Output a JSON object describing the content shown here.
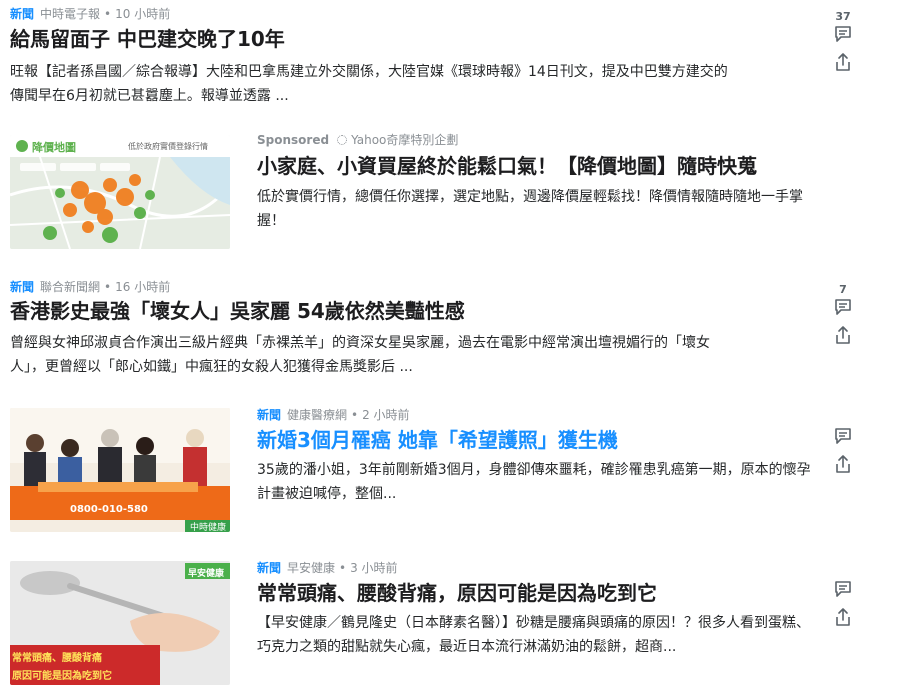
{
  "feed": [
    {
      "category": "新聞",
      "source": "中時電子報",
      "time": "10 小時前",
      "title": "給馬留面子 中巴建交晚了10年",
      "summary": "旺報【記者孫昌國／綜合報導】大陸和巴拿馬建立外交關係，大陸官媒《環球時報》14日刊文，提及中巴雙方建交的傳聞早在6月初就已甚囂塵上。報導並透露 ...",
      "comments": "37"
    },
    {
      "sponsored_label": "Sponsored",
      "source": "Yahoo奇摩特別企劃",
      "title": "小家庭、小資買屋終於能鬆口氣！【降價地圖】隨時快蒐",
      "summary": "低於實價行情，總價任你選擇，選定地點，週邊降價屋輕鬆找！降價情報隨時隨地一手掌握！",
      "thumb_logo": "降價地圖",
      "thumb_tag": "低於政府實價登錄行情"
    },
    {
      "category": "新聞",
      "source": "聯合新聞網",
      "time": "16 小時前",
      "title": "香港影史最強「壞女人」吳家麗 54歲依然美豔性感",
      "summary": "曾經與女神邱淑貞合作演出三級片經典「赤裸羔羊」的資深女星吳家麗，過去在電影中經常演出壇視媚行的「壞女人」，更曾經以「郎心如鐵」中瘋狂的女殺人犯獲得金馬獎影后 ...",
      "comments": "7"
    },
    {
      "category": "新聞",
      "source": "健康醫療網",
      "time": "2 小時前",
      "title": "新婚3個月罹癌 她靠「希望護照」獲生機",
      "summary": "35歲的潘小姐，3年前剛新婚3個月，身體卻傳來噩耗，確診罹患乳癌第一期，原本的懷孕計畫被迫喊停，整個...",
      "comments": "",
      "thumb_banner": "0800-010-580",
      "thumb_tag": "中時健康"
    },
    {
      "category": "新聞",
      "source": "早安健康",
      "time": "3 小時前",
      "title": "常常頭痛、腰酸背痛，原因可能是因為吃到它",
      "summary": "【早安健康／鶴見隆史（日本酵素名醫）】砂糖是腰痛與頭痛的原因！？很多人看到蛋糕、巧克力之類的甜點就失心瘋，最近日本流行淋滿奶油的鬆餅，超商...",
      "comments": "",
      "thumb_brand": "早安健康",
      "thumb_line1": "常常頭痛、腰酸背痛",
      "thumb_line2": "原因可能是因為吃到它"
    }
  ],
  "icons": {
    "comment": "comment-icon",
    "share": "share-icon"
  },
  "colors": {
    "category": "#188fff",
    "link_title": "#188fff",
    "meta": "#8a8f94",
    "map_green": "#5fb24f",
    "map_orange": "#f07f20",
    "banner_orange": "#ee6a18"
  }
}
